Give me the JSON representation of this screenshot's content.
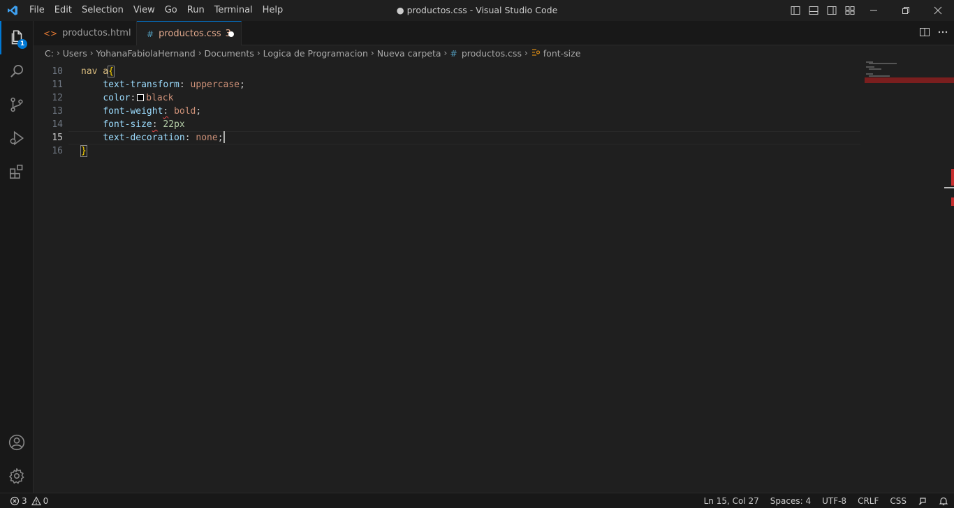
{
  "window": {
    "title": "● productos.css - Visual Studio Code"
  },
  "menu": [
    "File",
    "Edit",
    "Selection",
    "View",
    "Go",
    "Run",
    "Terminal",
    "Help"
  ],
  "activity_bar": {
    "explorer_badge": "1"
  },
  "tabs": [
    {
      "label": "productos.html",
      "icon": "html-file-icon",
      "icon_glyph": "<>",
      "active": false
    },
    {
      "label": "productos.css",
      "icon": "css-file-icon",
      "icon_glyph": "#",
      "problems": "3",
      "active": true,
      "modified": true
    }
  ],
  "breadcrumb": {
    "items": [
      "C:",
      "Users",
      "YohanaFabiolaHernand",
      "Documents",
      "Logica de Programacion",
      "Nueva carpeta",
      "productos.css",
      "font-size"
    ]
  },
  "editor": {
    "line_numbers": [
      "10",
      "11",
      "12",
      "13",
      "14",
      "15",
      "16"
    ],
    "current_line": "15",
    "code": {
      "l10_selector": "nav a",
      "l10_brace": "{",
      "l11_prop": "text-transform",
      "l11_val": "uppercase",
      "l12_prop": "color",
      "l12_val": "black",
      "l13_prop": "font-weight",
      "l13_val": "bold",
      "l14_prop": "font-size",
      "l14_val": "22px",
      "l15_prop": "text-decoration",
      "l15_val": "none",
      "l16_brace": "}"
    }
  },
  "status": {
    "errors": "3",
    "warnings": "0",
    "position": "Ln 15, Col 27",
    "spaces": "Spaces: 4",
    "encoding": "UTF-8",
    "eol": "CRLF",
    "language": "CSS"
  },
  "colors": {
    "accent": "#0078d4",
    "error": "#f14c4c",
    "tab_modified_text": "#e2a98d"
  }
}
